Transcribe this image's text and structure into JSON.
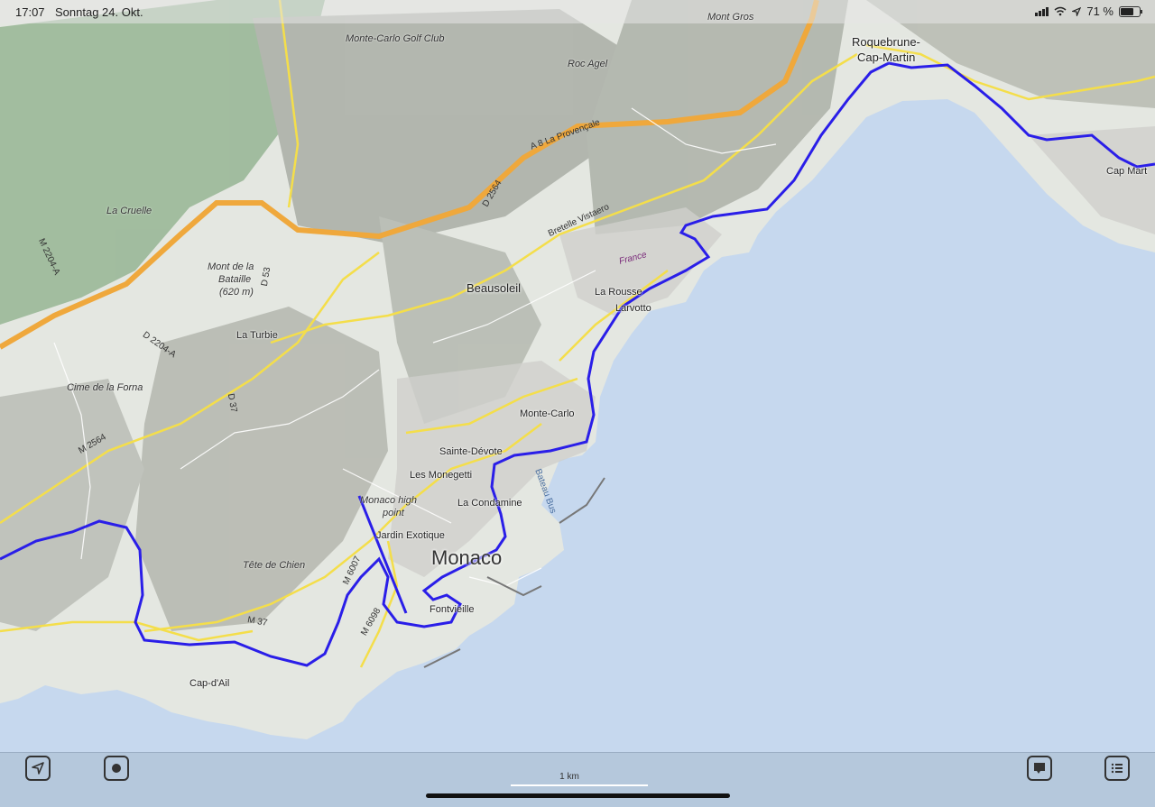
{
  "status_bar": {
    "time": "17:07",
    "date": "Sonntag 24. Okt.",
    "battery": "71 %",
    "battery_level": 0.71
  },
  "map": {
    "land_color": "#e9ece6",
    "sea_color": "#c6d8ee",
    "route_color": "#2a1ee8",
    "road_color": "#f4de4a",
    "motorway_color": "#efa83c",
    "labels": {
      "roquebrune": "Roquebrune-",
      "cap_martin_town": "Cap-Martin",
      "cap_martin": "Cap Mart",
      "monte_carlo_golf": "Monte-Carlo Golf Club",
      "mont_gros": "Mont Gros",
      "roc_agel": "Roc Agel",
      "a8": "A 8 La Provençale",
      "d2564": "D 2564",
      "bretelle": "Bretelle Vistaero",
      "la_cruelle": "La Cruelle",
      "m2204a": "M 2204-A",
      "mont_bataille": "Mont de la",
      "bataille": "Bataille",
      "bataille_ele": "(620 m)",
      "d53": "D 53",
      "beausoleil": "Beausoleil",
      "france": "France",
      "la_rousse": "La Rousse",
      "larvotto": "Larvotto",
      "la_turbie": "La Turbie",
      "d2204a": "D 2204-A",
      "cime_forna": "Cime de la Forna",
      "d37": "D 37",
      "m2564": "M 2564",
      "monte_carlo": "Monte-Carlo",
      "sainte_devote": "Sainte-Dévote",
      "les_monegetti": "Les Monegetti",
      "monaco_high": "Monaco high",
      "point": "point",
      "la_condamine": "La Condamine",
      "bateau_bus": "Bateau Bus",
      "jardin_exotique": "Jardin Exotique",
      "monaco": "Monaco",
      "tete_chien": "Tête de Chien",
      "m6007": "M 6007",
      "m37": "M 37",
      "m6098": "M 6098",
      "fontvieille": "Fontvieille",
      "cap_dail": "Cap-d'Ail"
    }
  },
  "bottom_bar": {
    "scale_label": "1 km",
    "buttons": {
      "locate": "location-arrow-icon",
      "record": "record-icon",
      "comment": "comment-icon",
      "list": "list-icon"
    }
  }
}
